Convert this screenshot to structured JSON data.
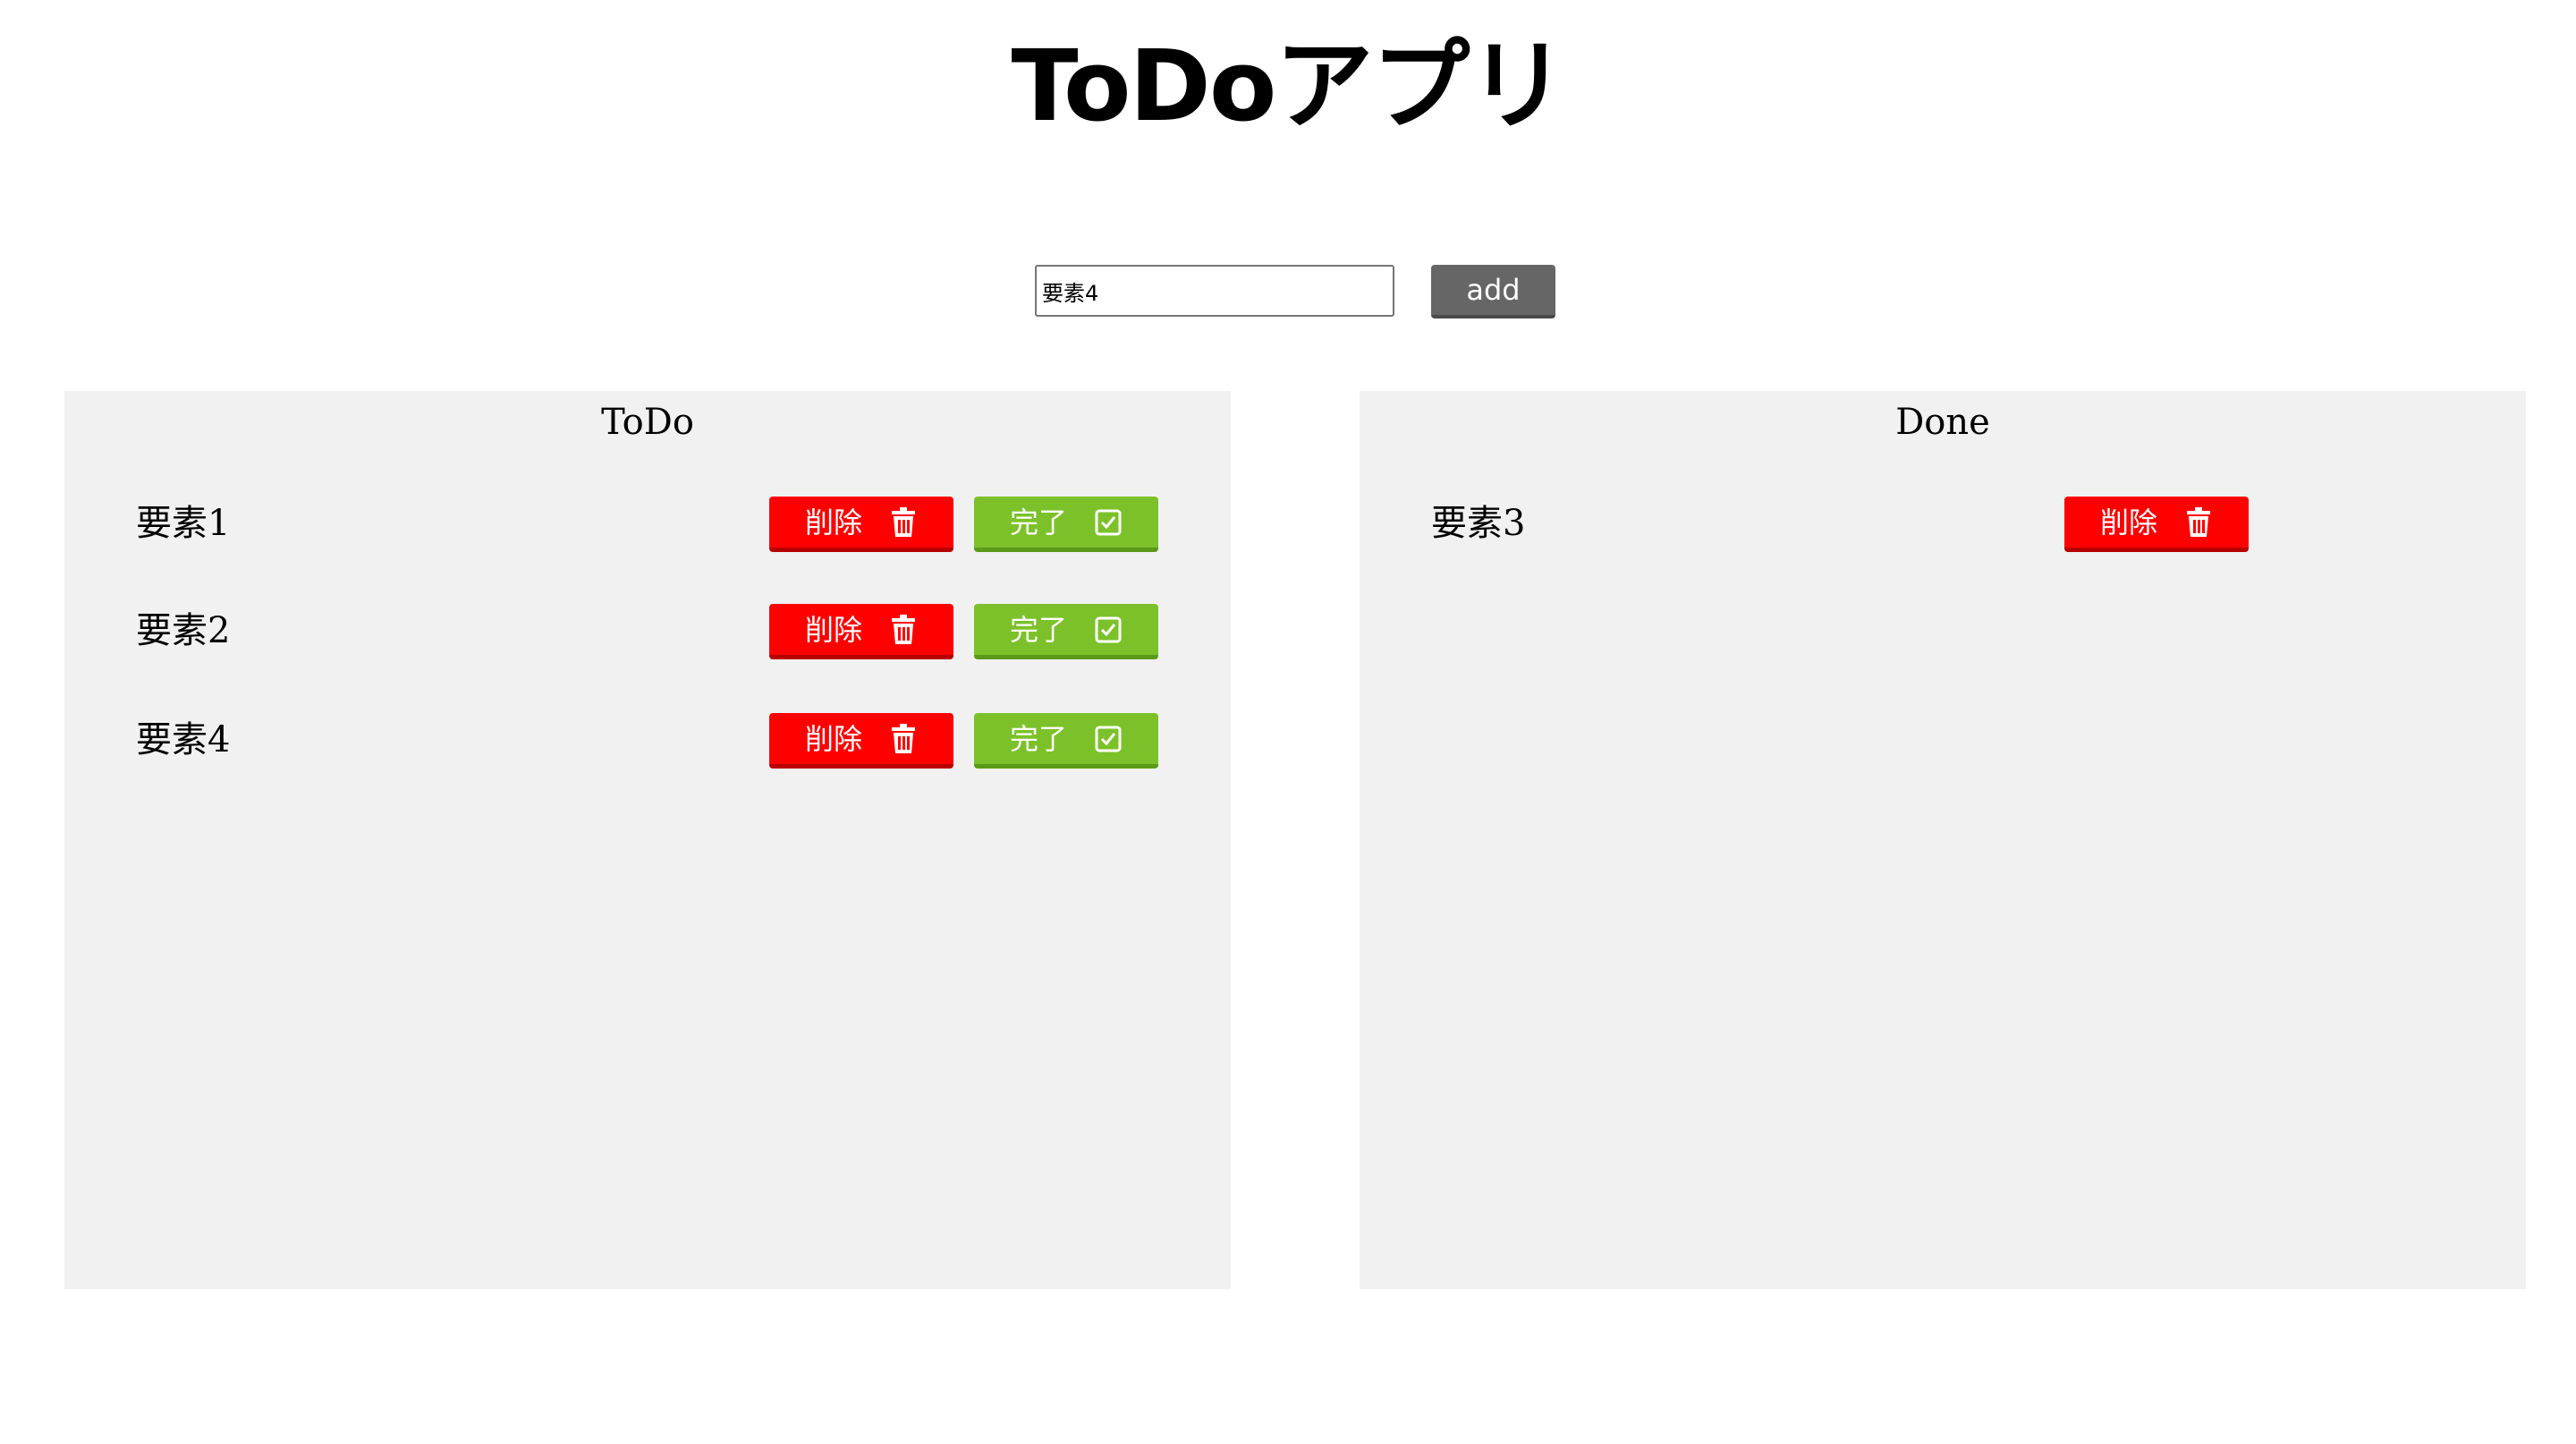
{
  "header": {
    "title": "ToDoアプリ"
  },
  "input_area": {
    "value": "要素4",
    "placeholder": "",
    "add_label": "add"
  },
  "todo": {
    "heading": "ToDo",
    "items": [
      {
        "label": "要素1",
        "delete_label": "削除",
        "complete_label": "完了"
      },
      {
        "label": "要素2",
        "delete_label": "削除",
        "complete_label": "完了"
      },
      {
        "label": "要素4",
        "delete_label": "削除",
        "complete_label": "完了"
      }
    ]
  },
  "done": {
    "heading": "Done",
    "items": [
      {
        "label": "要素3",
        "delete_label": "削除"
      }
    ]
  },
  "icons": {
    "delete": "trash-icon",
    "complete": "checkbox-icon"
  },
  "colors": {
    "delete_button": "#ff0000",
    "complete_button": "#7cc12a",
    "add_button": "#666666",
    "panel_background": "#f1f1f1"
  }
}
